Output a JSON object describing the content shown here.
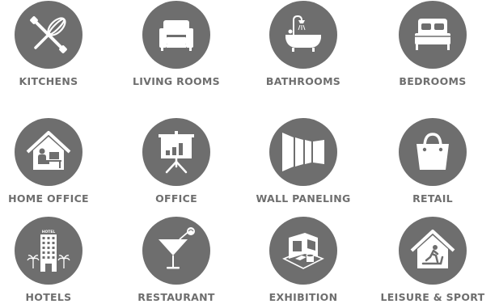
{
  "colors": {
    "icon_circle": "#6e6e6e",
    "icon_glyph": "#ffffff",
    "label": "#6e6e6e",
    "background": "#ffffff"
  },
  "categories": [
    {
      "label": "KITCHENS",
      "icon": "whisk-rolling-pin-icon"
    },
    {
      "label": "LIVING ROOMS",
      "icon": "armchair-icon"
    },
    {
      "label": "BATHROOMS",
      "icon": "bathtub-icon"
    },
    {
      "label": "BEDROOMS",
      "icon": "bed-icon"
    },
    {
      "label": "HOME OFFICE",
      "icon": "house-desk-icon"
    },
    {
      "label": "OFFICE",
      "icon": "presentation-board-icon"
    },
    {
      "label": "WALL PANELING",
      "icon": "wall-panels-icon"
    },
    {
      "label": "RETAIL",
      "icon": "shopping-bag-icon"
    },
    {
      "label": "HOTELS",
      "icon": "hotel-building-icon",
      "sign": "HOTEL"
    },
    {
      "label": "RESTAURANT",
      "icon": "cocktail-glass-icon"
    },
    {
      "label": "EXHIBITION",
      "icon": "exhibition-booth-icon"
    },
    {
      "label": "LEISURE & SPORT",
      "icon": "house-treadmill-icon"
    }
  ]
}
